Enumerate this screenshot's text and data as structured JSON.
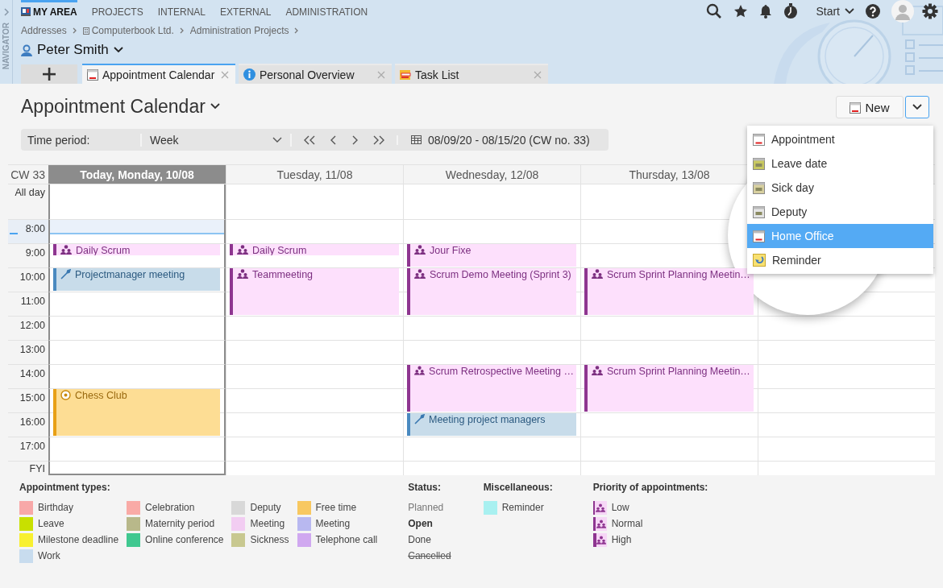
{
  "navigator": {
    "label": "NAVIGATOR"
  },
  "top_menu": [
    {
      "label": "MY AREA",
      "selected": true
    },
    {
      "label": "PROJECTS",
      "selected": false
    },
    {
      "label": "INTERNAL",
      "selected": false
    },
    {
      "label": "EXTERNAL",
      "selected": false
    },
    {
      "label": "ADMINISTRATION",
      "selected": false
    }
  ],
  "top_actions": {
    "start": "Start"
  },
  "breadcrumb": [
    {
      "label": "Addresses",
      "kind": "plain"
    },
    {
      "label": "Computerbook Ltd.",
      "kind": "company"
    },
    {
      "label": "Administration Projects",
      "kind": "plain"
    }
  ],
  "user": {
    "name": "Peter Smith"
  },
  "tabs": [
    {
      "label": "Appointment Calendar",
      "kind": "calendar",
      "selected": true
    },
    {
      "label": "Personal Overview",
      "kind": "info",
      "selected": false
    },
    {
      "label": "Task List",
      "kind": "tasks",
      "selected": false
    }
  ],
  "page": {
    "title": "Appointment Calendar"
  },
  "toolbar": {
    "label": "Time period:",
    "period": "Week",
    "range": "08/09/20 - 08/15/20 (CW no. 33)"
  },
  "new_button": {
    "label": "New",
    "expanded": true
  },
  "new_menu": [
    {
      "label": "Appointment",
      "kind": "appointment",
      "selected": false
    },
    {
      "label": "Leave date",
      "kind": "leave",
      "selected": false
    },
    {
      "label": "Sick day",
      "kind": "sick",
      "selected": false
    },
    {
      "label": "Deputy",
      "kind": "deputy",
      "selected": false
    },
    {
      "label": "Home Office",
      "kind": "appointment",
      "selected": true
    },
    {
      "label": "Reminder",
      "kind": "reminder",
      "selected": false
    }
  ],
  "calendar": {
    "week": "CW 33",
    "all_day": "All day",
    "fyi": "FYI",
    "days": [
      {
        "label": "Today, Monday, 10/08",
        "today": true
      },
      {
        "label": "Tuesday, 11/08",
        "today": false
      },
      {
        "label": "Wednesday, 12/08",
        "today": false
      },
      {
        "label": "Thursday, 13/08",
        "today": false
      }
    ],
    "rows": [
      {
        "label": "8:00",
        "current": true
      },
      {
        "label": "9:00",
        "current": false,
        "cells": [
          [
            {
              "title": "Daily Scrum",
              "kind": "short-meeting"
            }
          ],
          [
            {
              "title": "Daily Scrum",
              "kind": "short-meeting"
            }
          ],
          [
            {
              "title": "Jour Fixe",
              "kind": "meeting"
            }
          ],
          []
        ]
      },
      {
        "label": "10:00",
        "current": false,
        "cells": [
          [
            {
              "title": "Projectmanager meeting",
              "kind": "work"
            }
          ],
          [
            {
              "title": "Teammeeting",
              "kind": "long-meeting"
            }
          ],
          [
            {
              "title": "Scrum Demo Meeting (Sprint 3)",
              "kind": "long-meeting"
            }
          ],
          [
            {
              "title": "Scrum Sprint Planning Meetin…",
              "kind": "long-meeting"
            }
          ]
        ]
      },
      {
        "label": "11:00",
        "current": false
      },
      {
        "label": "12:00",
        "current": false
      },
      {
        "label": "13:00",
        "current": false
      },
      {
        "label": "14:00",
        "current": false,
        "cells": [
          [],
          [],
          [
            {
              "title": "Scrum Retrospective Meeting …",
              "kind": "long-meeting"
            }
          ],
          [
            {
              "title": "Scrum Sprint Planning Meetin…",
              "kind": "long-meeting"
            }
          ]
        ]
      },
      {
        "label": "15:00",
        "current": false,
        "cells": [
          [
            {
              "title": "Chess Club",
              "kind": "long-free-time"
            }
          ],
          [],
          [],
          []
        ]
      },
      {
        "label": "16:00",
        "current": false,
        "cells": [
          [],
          [],
          [
            {
              "title": "Meeting project managers",
              "kind": "work"
            }
          ],
          []
        ]
      },
      {
        "label": "17:00",
        "current": false
      }
    ]
  },
  "legend": {
    "types_title": "Appointment types:",
    "types": [
      [
        {
          "label": "Birthday",
          "color": "#f8a8a8"
        },
        {
          "label": "Leave",
          "color": "#c8e000"
        },
        {
          "label": "Milestone deadline",
          "color": "#f8f030"
        },
        {
          "label": "Work",
          "color": "#c8dcee"
        }
      ],
      [
        {
          "label": "Celebration",
          "color": "#f9aaa6"
        },
        {
          "label": "Maternity period",
          "color": "#b8b88a"
        },
        {
          "label": "Online conference",
          "color": "#40c890"
        }
      ],
      [
        {
          "label": "Deputy",
          "color": "#d8d8d8"
        },
        {
          "label": "Meeting",
          "color": "#f2cdf2"
        },
        {
          "label": "Sickness",
          "color": "#c8c890"
        }
      ],
      [
        {
          "label": "Free time",
          "color": "#f8c860"
        },
        {
          "label": "Meeting",
          "color": "#b8b8f0"
        },
        {
          "label": "Telephone call",
          "color": "#d0a8f0"
        }
      ]
    ],
    "status_title": "Status:",
    "statuses": [
      {
        "label": "Planned",
        "kind": "planned"
      },
      {
        "label": "Open",
        "kind": "open"
      },
      {
        "label": "Done",
        "kind": "done"
      },
      {
        "label": "Cancelled",
        "kind": "cancelled"
      }
    ],
    "misc_title": "Miscellaneous:",
    "misc": [
      {
        "label": "Reminder",
        "color": "#a8f0f0"
      }
    ],
    "priority_title": "Priority of appointments:",
    "priorities": [
      {
        "label": "Low",
        "kind": "low"
      },
      {
        "label": "Normal",
        "kind": "normal"
      },
      {
        "label": "High",
        "kind": "high"
      }
    ]
  }
}
